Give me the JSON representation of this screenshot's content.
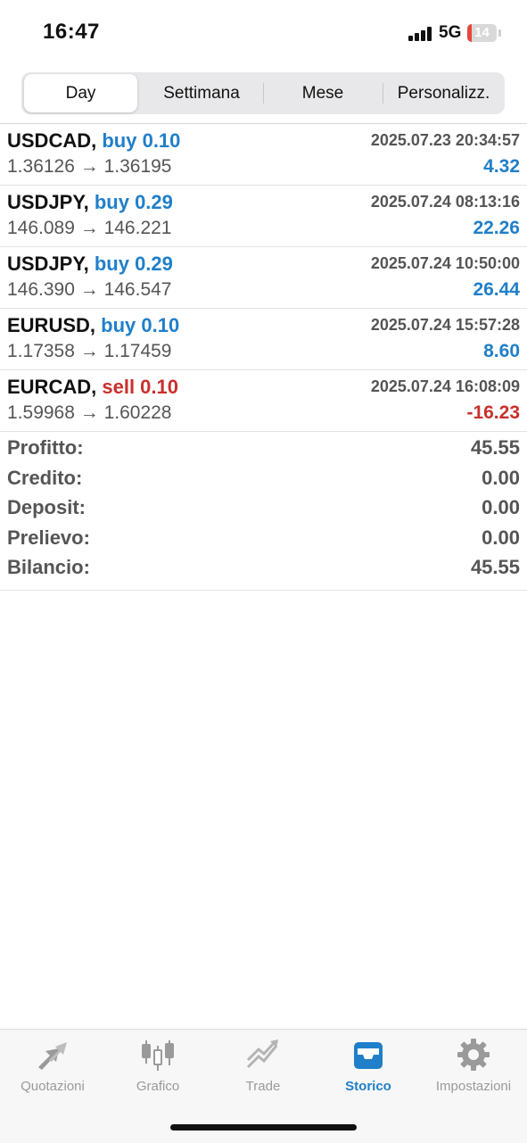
{
  "status_bar": {
    "time": "16:47",
    "network": "5G",
    "battery": "14",
    "battery_level": 0.14
  },
  "period_tabs": [
    {
      "label": "Day",
      "active": true
    },
    {
      "label": "Settimana",
      "active": false
    },
    {
      "label": "Mese",
      "active": false
    },
    {
      "label": "Personalizz.",
      "active": false
    }
  ],
  "trades": [
    {
      "symbol": "USDCAD,",
      "side": "buy 0.10",
      "type": "buy",
      "datetime": "2025.07.23 20:34:57",
      "prices": "1.36126 → 1.36195",
      "profit": "4.32"
    },
    {
      "symbol": "USDJPY,",
      "side": "buy 0.29",
      "type": "buy",
      "datetime": "2025.07.24 08:13:16",
      "prices": "146.089 → 146.221",
      "profit": "22.26"
    },
    {
      "symbol": "USDJPY,",
      "side": "buy 0.29",
      "type": "buy",
      "datetime": "2025.07.24 10:50:00",
      "prices": "146.390 → 146.547",
      "profit": "26.44"
    },
    {
      "symbol": "EURUSD,",
      "side": "buy 0.10",
      "type": "buy",
      "datetime": "2025.07.24 15:57:28",
      "prices": "1.17358 → 1.17459",
      "profit": "8.60"
    },
    {
      "symbol": "EURCAD,",
      "side": "sell 0.10",
      "type": "sell",
      "datetime": "2025.07.24 16:08:09",
      "prices": "1.59968 → 1.60228",
      "profit": "-16.23"
    }
  ],
  "summary": [
    {
      "label": "Profitto:",
      "value": "45.55"
    },
    {
      "label": "Credito:",
      "value": "0.00"
    },
    {
      "label": "Deposit:",
      "value": "0.00"
    },
    {
      "label": "Prelievo:",
      "value": "0.00"
    },
    {
      "label": "Bilancio:",
      "value": "45.55"
    }
  ],
  "tabbar": [
    {
      "label": "Quotazioni",
      "icon": "quotes-arrows-icon",
      "active": false
    },
    {
      "label": "Grafico",
      "icon": "candlestick-icon",
      "active": false
    },
    {
      "label": "Trade",
      "icon": "trend-line-icon",
      "active": false
    },
    {
      "label": "Storico",
      "icon": "inbox-tray-icon",
      "active": true
    },
    {
      "label": "Impostazioni",
      "icon": "gear-icon",
      "active": false
    }
  ],
  "colors": {
    "buy": "#1f7fc9",
    "sell": "#c9302c",
    "active_tab": "#1f7fc9",
    "inactive_tab": "#9a9a9a"
  }
}
